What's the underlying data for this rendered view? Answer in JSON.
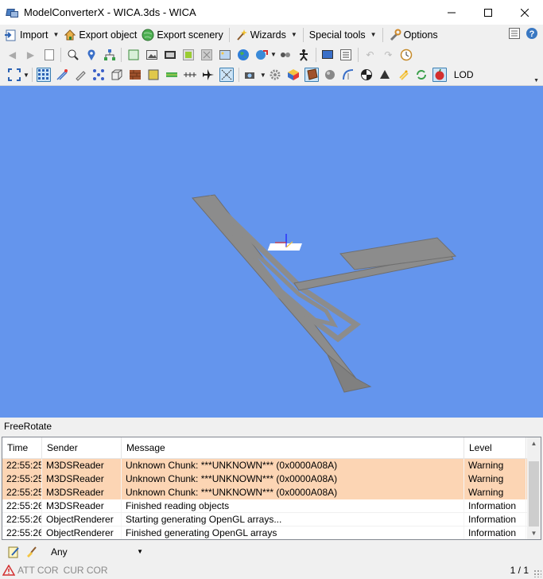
{
  "window": {
    "title": "ModelConverterX - WICA.3ds - WICA",
    "min": "—",
    "max": "☐",
    "close": "✕"
  },
  "menu": {
    "import": "Import",
    "export_object": "Export object",
    "export_scenery": "Export scenery",
    "wizards": "Wizards",
    "special_tools": "Special tools",
    "options": "Options"
  },
  "toolbar3": {
    "lod_label": "LOD"
  },
  "viewport": {
    "background": "#6495ed",
    "mode": "FreeRotate"
  },
  "log": {
    "headers": {
      "time": "Time",
      "sender": "Sender",
      "message": "Message",
      "level": "Level"
    },
    "rows": [
      {
        "time": "22:55:25",
        "sender": "M3DSReader",
        "message": "Unknown Chunk: ***UNKNOWN*** (0x0000A08A)",
        "level": "Warning"
      },
      {
        "time": "22:55:25",
        "sender": "M3DSReader",
        "message": "Unknown Chunk: ***UNKNOWN*** (0x0000A08A)",
        "level": "Warning"
      },
      {
        "time": "22:55:25",
        "sender": "M3DSReader",
        "message": "Unknown Chunk: ***UNKNOWN*** (0x0000A08A)",
        "level": "Warning"
      },
      {
        "time": "22:55:26",
        "sender": "M3DSReader",
        "message": "Finished reading objects",
        "level": "Information"
      },
      {
        "time": "22:55:26",
        "sender": "ObjectRenderer",
        "message": "Starting generating OpenGL arrays...",
        "level": "Information"
      },
      {
        "time": "22:55:26",
        "sender": "ObjectRenderer",
        "message": "Finished generating OpenGL arrays",
        "level": "Information"
      }
    ]
  },
  "filter": {
    "value": "Any"
  },
  "status": {
    "att_cor": "ATT COR",
    "cur_cor": "CUR COR",
    "page": "1 / 1"
  },
  "colors": {
    "warning_row": "#fcd5b4",
    "accent": "#3c7fb1"
  }
}
